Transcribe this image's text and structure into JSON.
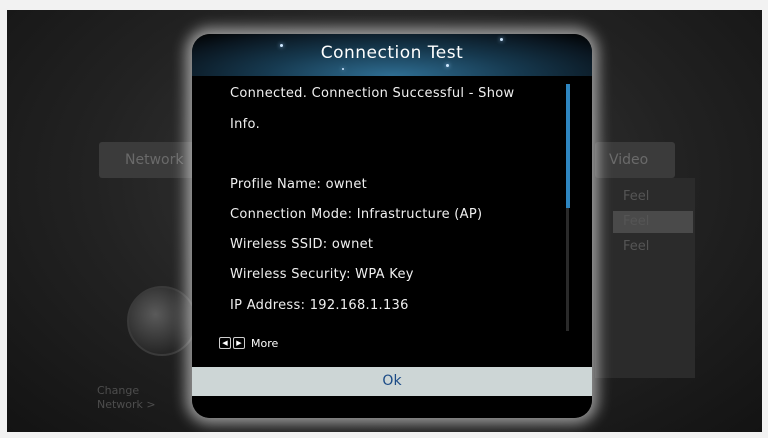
{
  "background_menu": {
    "header_left": "Network",
    "header_right": "Video",
    "options": [
      "Feel",
      "Feel",
      "Feel"
    ],
    "hint_line1": "Change",
    "hint_line2": "Network >"
  },
  "dialog": {
    "title": "Connection Test",
    "lines": [
      "Connected. Connection Successful - Show",
      "Info.",
      "",
      "Profile Name: ownet",
      "Connection Mode: Infrastructure (AP)",
      "Wireless SSID: ownet",
      "Wireless Security: WPA Key",
      "IP Address: 192.168.1.136"
    ],
    "more_label": "More",
    "ok_label": "Ok"
  },
  "colors": {
    "accent": "#2e86c1",
    "ok_text": "#1a4a86",
    "ok_bg": "#cdd6d6"
  },
  "icons": {
    "prev": "left-arrow-key-icon",
    "next": "right-arrow-key-icon"
  }
}
